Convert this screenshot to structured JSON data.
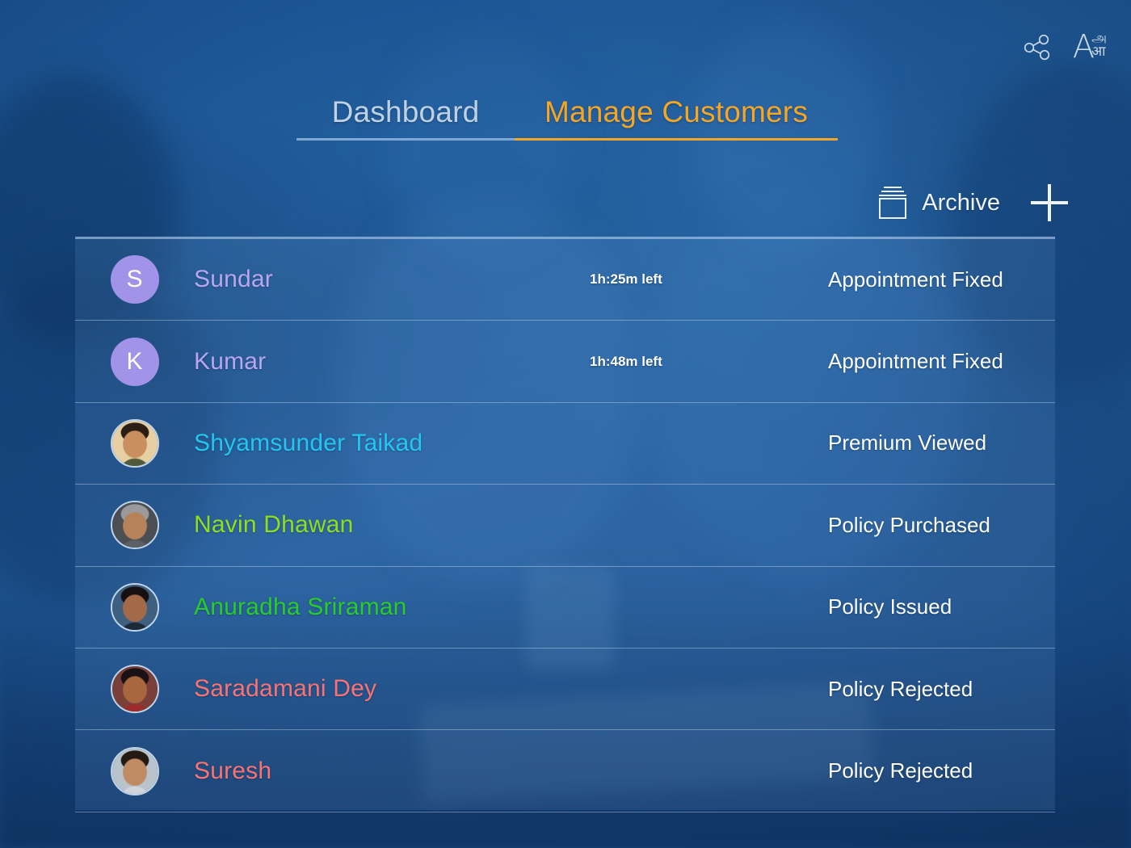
{
  "topbar": {
    "share_icon": "share-icon",
    "language_icon": "language-icon",
    "language_latin": "A",
    "language_tamil": "அ",
    "language_devanagari": "आ"
  },
  "tabs": {
    "items": [
      {
        "label": "Dashboard",
        "active": false
      },
      {
        "label": "Manage Customers",
        "active": true
      }
    ],
    "active_color": "#f5a623",
    "inactive_color": "#bfd2e4"
  },
  "actions": {
    "archive_label": "Archive",
    "archive_icon": "archive-box-icon",
    "add_icon": "plus-icon"
  },
  "customers": [
    {
      "name": "Sundar",
      "name_color": "#b9a6ef",
      "avatar_type": "initial",
      "initial": "S",
      "avatar_color": "#a193e8",
      "time_left": "1h:25m left",
      "status": "Appointment Fixed"
    },
    {
      "name": "Kumar",
      "name_color": "#b9a6ef",
      "avatar_type": "initial",
      "initial": "K",
      "avatar_color": "#a193e8",
      "time_left": "1h:48m left",
      "status": "Appointment Fixed"
    },
    {
      "name": "Shyamsunder Taikad",
      "name_color": "#24c6f0",
      "avatar_type": "photo",
      "initial": "",
      "avatar_color": "#d9b98a",
      "time_left": "",
      "status": "Premium Viewed"
    },
    {
      "name": "Navin Dhawan",
      "name_color": "#8fe01b",
      "avatar_type": "photo",
      "initial": "",
      "avatar_color": "#8d8d8f",
      "time_left": "",
      "status": "Policy Purchased"
    },
    {
      "name": "Anuradha Sriraman",
      "name_color": "#29cc29",
      "avatar_type": "photo",
      "initial": "",
      "avatar_color": "#6d5a52",
      "time_left": "",
      "status": "Policy Issued"
    },
    {
      "name": "Saradamani Dey",
      "name_color": "#fa7272",
      "avatar_type": "photo",
      "initial": "",
      "avatar_color": "#7a4a3c",
      "time_left": "",
      "status": "Policy Rejected"
    },
    {
      "name": "Suresh",
      "name_color": "#fa7272",
      "avatar_type": "photo",
      "initial": "",
      "avatar_color": "#6f5244",
      "time_left": "",
      "status": "Policy Rejected"
    }
  ]
}
